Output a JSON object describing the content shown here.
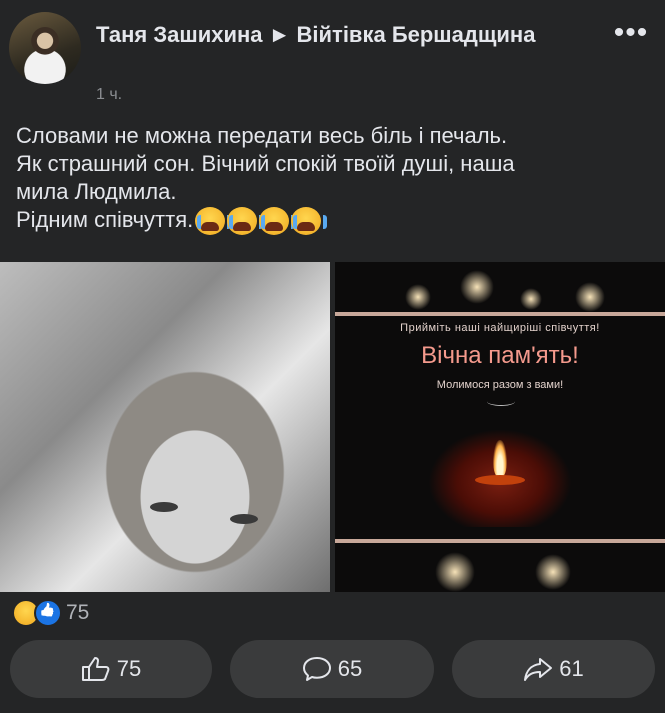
{
  "post": {
    "author": "Таня Зашихина ► Війтівка Бершадщина",
    "time": "1 ч.",
    "text_lines": [
      "Словами не можна передати весь біль і печаль.",
      "Як страшний сон. Вічний спокій твоїй душі, наша",
      "мила Людмила."
    ],
    "last_line": "Рідним співчуття."
  },
  "image_right": {
    "line1": "Прийміть наші найщиріші співчуття!",
    "title": "Вічна пам'ять!",
    "line3": "Молимося разом з вами!"
  },
  "reactions": {
    "count": "75"
  },
  "actions": {
    "like_count": "75",
    "comment_count": "65",
    "share_count": "61"
  },
  "icons": {
    "more": "more-icon",
    "like": "thumbs-up-icon",
    "comment": "comment-icon",
    "share": "share-icon"
  }
}
